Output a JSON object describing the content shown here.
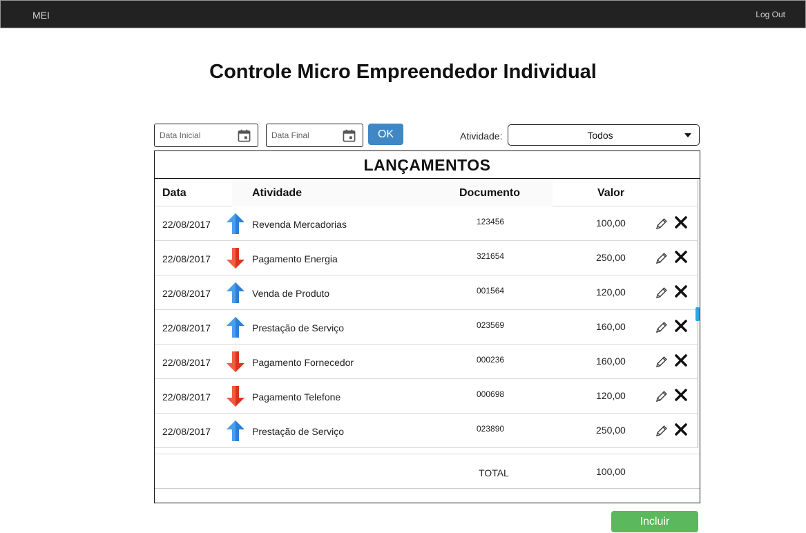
{
  "nav": {
    "brand": "MEI",
    "logout": "Log Out"
  },
  "page": {
    "title": "Controle Micro Empreendedor Individual"
  },
  "filters": {
    "data_inicial_placeholder": "Data Inicial",
    "data_final_placeholder": "Data Final",
    "ok_label": "OK",
    "atividade_label": "Atividade:",
    "atividade_selected": "Todos"
  },
  "table": {
    "title": "LANÇAMENTOS",
    "headers": {
      "data": "Data",
      "atividade": "Atividade",
      "documento": "Documento",
      "valor": "Valor"
    },
    "rows": [
      {
        "data": "22/08/2017",
        "direction": "up",
        "atividade": "Revenda Mercadorias",
        "documento": "123456",
        "valor": "100,00"
      },
      {
        "data": "22/08/2017",
        "direction": "down",
        "atividade": "Pagamento Energia",
        "documento": "321654",
        "valor": "250,00"
      },
      {
        "data": "22/08/2017",
        "direction": "up",
        "atividade": "Venda de Produto",
        "documento": "001564",
        "valor": "120,00"
      },
      {
        "data": "22/08/2017",
        "direction": "up",
        "atividade": "Prestação de Serviço",
        "documento": "023569",
        "valor": "160,00"
      },
      {
        "data": "22/08/2017",
        "direction": "down",
        "atividade": "Pagamento Fornecedor",
        "documento": "000236",
        "valor": "160,00"
      },
      {
        "data": "22/08/2017",
        "direction": "down",
        "atividade": "Pagamento Telefone",
        "documento": "000698",
        "valor": "120,00"
      },
      {
        "data": "22/08/2017",
        "direction": "up",
        "atividade": "Prestação de Serviço",
        "documento": "023890",
        "valor": "250,00"
      }
    ],
    "total_label": "TOTAL",
    "total_value": "100,00"
  },
  "actions": {
    "incluir_label": "Incluir"
  },
  "colors": {
    "navbar": "#222222",
    "ok_button": "#3f88c5",
    "incluir_button": "#5cb85c",
    "up_arrow": "#2b7fd6",
    "down_arrow": "#d9341c"
  },
  "icons": {
    "date": "calendar-icon",
    "up": "arrow-up-icon",
    "down": "arrow-down-icon",
    "edit": "pencil-icon",
    "delete": "close-icon",
    "select": "caret-down-icon"
  }
}
